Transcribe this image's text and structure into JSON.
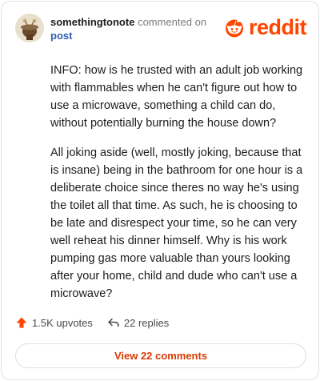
{
  "brand": {
    "name": "reddit",
    "color": "#ff4500"
  },
  "comment": {
    "author": "somethingtonote",
    "action_text": "commented on",
    "target_text": "post",
    "paragraphs": [
      "INFO: how is he trusted with an adult job working with flammables when he can't figure out how to use a microwave, something a child can do, without potentially burning the house down?",
      "All joking aside (well, mostly joking, because that is insane) being in the bathroom for one hour is a deliberate choice since theres no way he's using the toilet all that time. As such, he is choosing to be late and disrespect your time, so he can very well reheat his dinner himself. Why is his work pumping gas more valuable than yours looking after your home, child and dude who can't use a microwave?"
    ]
  },
  "actions": {
    "upvotes_label": "1.5K upvotes",
    "replies_label": "22 replies",
    "upvote_icon": "upvote-arrow-icon",
    "reply_icon": "reply-arrow-icon"
  },
  "footer": {
    "view_button_label": "View 22 comments"
  },
  "colors": {
    "upvote": "#ff4500",
    "link": "#2a5db0",
    "button_text": "#d93a00"
  }
}
